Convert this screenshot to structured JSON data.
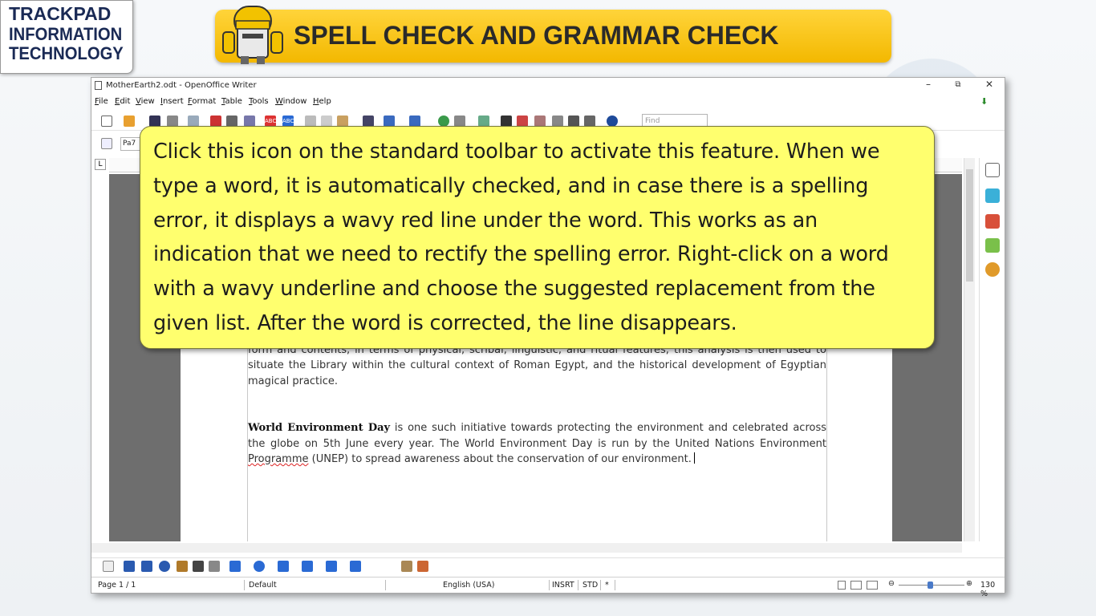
{
  "logo": {
    "line1": "TRACKPAD",
    "line2": "INFORMATION",
    "line3": "TECHNOLOGY"
  },
  "banner": {
    "title": "SPELL CHECK AND GRAMMAR CHECK"
  },
  "window": {
    "title": "MotherEarth2.odt - OpenOffice Writer",
    "controls": {
      "minimize": "–",
      "restore": "⧉",
      "close": "✕"
    }
  },
  "menu": [
    "File",
    "Edit",
    "View",
    "Insert",
    "Format",
    "Table",
    "Tools",
    "Window",
    "Help"
  ],
  "find": {
    "placeholder": "Find"
  },
  "style_box": "Pa7",
  "ruler_corner": "L",
  "document": {
    "para1": "The first chapter examines the evidence for this archive, its publication and reception history, as well as its form and contents, in terms of physical, scribal, linguistic, and ritual features; this analysis is then used to situate the Library within the cultural context of Roman Egypt, and the historical development of Egyptian magical practice.",
    "para2_bold": "World Environment Day",
    "para2_rest": " is one such initiative towards protecting the environment and celebrated across the globe on 5th June every year. The World Environment Day is run by the United Nations Environment ",
    "para2_misspelled": "Programme",
    "para2_end": " (UNEP) to spread awareness about the conservation of our environment."
  },
  "statusbar": {
    "page": "Page 1 / 1",
    "style": "Default",
    "language": "English (USA)",
    "insert_mode": "INSRT",
    "selection_mode": "STD",
    "modified": "*",
    "zoom": "130 %"
  },
  "callout": {
    "text": "Click this icon on the standard toolbar to activate this feature. When we type a word, it is automatically checked, and in case there is a spelling error, it displays a wavy red line under the word. This works as an indication that we need to rectify the spelling error. Right-click on a word with a wavy underline and choose the suggested replacement from the given list. After the word is corrected, the line disappears."
  },
  "colors": {
    "banner": "#ffd43a",
    "callout": "#ffff6e",
    "logo_text": "#1a2a55",
    "squiggle": "#dd2222"
  }
}
